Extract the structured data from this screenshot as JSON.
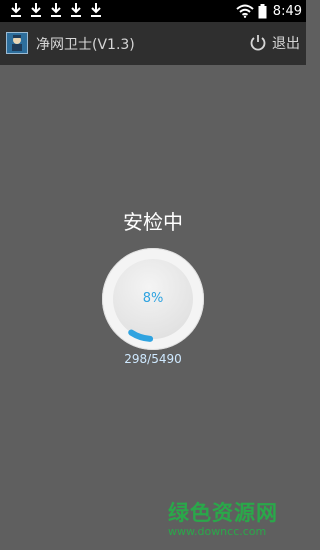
{
  "statusbar": {
    "time": "8:49",
    "download_icons": [
      "download-icon",
      "download-icon",
      "download-icon",
      "download-icon",
      "download-icon"
    ]
  },
  "appbar": {
    "title": "净网卫士(V1.3)",
    "logout_label": "退出"
  },
  "main": {
    "heading": "安检中",
    "progress_percent_text": "8%",
    "progress_fraction": 0.08,
    "counter_text": "298/5490"
  },
  "watermark": {
    "brand": "绿色资源网",
    "url": "www.downcc.com"
  },
  "colors": {
    "background": "#5f5f5f",
    "appbar": "#2f2f2f",
    "accent": "#2fa3e0",
    "watermark": "#2aa84a"
  }
}
